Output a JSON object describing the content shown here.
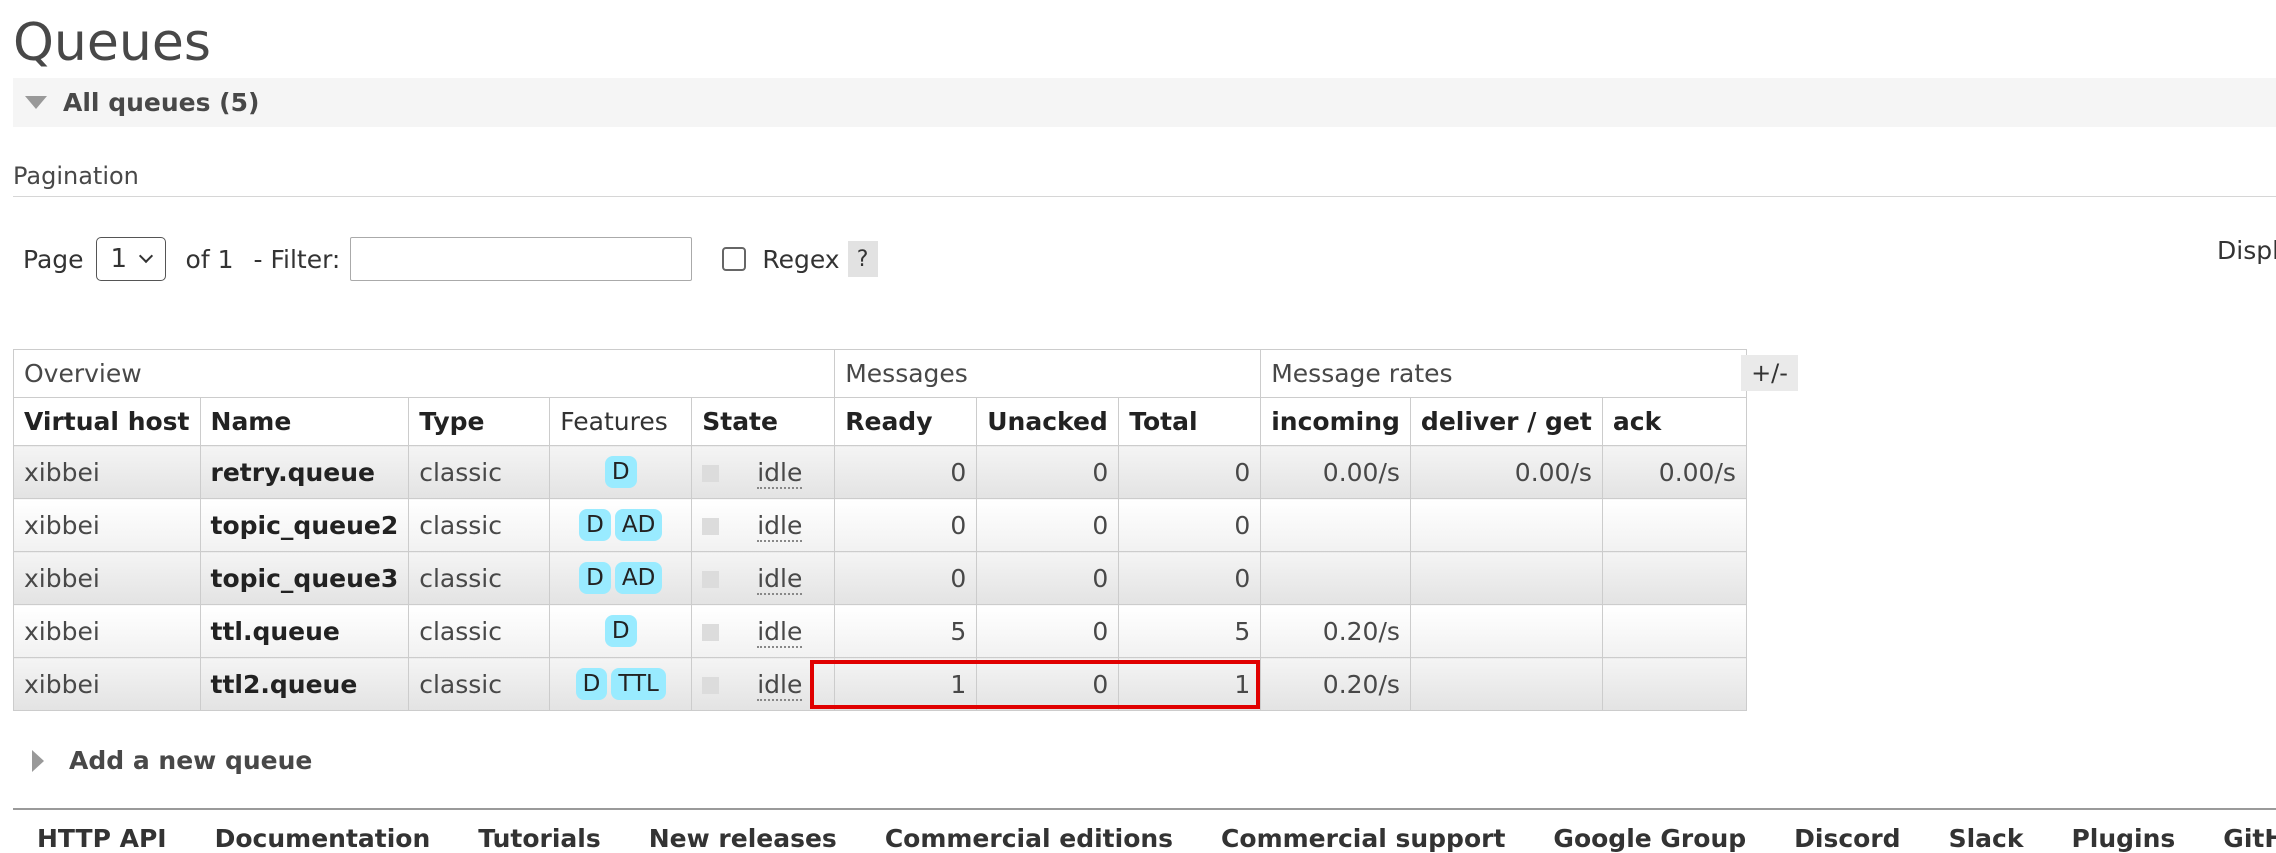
{
  "page_title": "Queues",
  "section": {
    "label": "All queues (5)"
  },
  "pagination": {
    "label": "Pagination",
    "page_label": "Page",
    "page_value": "1",
    "of_label": "of 1",
    "filter_label": "- Filter:",
    "filter_value": "",
    "regex_label": "Regex",
    "help_label": "?",
    "displaying_label": "Displ"
  },
  "table": {
    "groups": [
      "Overview",
      "Messages",
      "Message rates"
    ],
    "columns": [
      "Virtual host",
      "Name",
      "Type",
      "Features",
      "State",
      "Ready",
      "Unacked",
      "Total",
      "incoming",
      "deliver / get",
      "ack"
    ],
    "toggle_label": "+/-",
    "rows": [
      {
        "vhost": "xibbei",
        "name": "retry.queue",
        "type": "classic",
        "features": [
          "D"
        ],
        "state": "idle",
        "ready": "0",
        "unacked": "0",
        "total": "0",
        "incoming": "0.00/s",
        "deliver_get": "0.00/s",
        "ack": "0.00/s"
      },
      {
        "vhost": "xibbei",
        "name": "topic_queue2",
        "type": "classic",
        "features": [
          "D",
          "AD"
        ],
        "state": "idle",
        "ready": "0",
        "unacked": "0",
        "total": "0",
        "incoming": "",
        "deliver_get": "",
        "ack": ""
      },
      {
        "vhost": "xibbei",
        "name": "topic_queue3",
        "type": "classic",
        "features": [
          "D",
          "AD"
        ],
        "state": "idle",
        "ready": "0",
        "unacked": "0",
        "total": "0",
        "incoming": "",
        "deliver_get": "",
        "ack": ""
      },
      {
        "vhost": "xibbei",
        "name": "ttl.queue",
        "type": "classic",
        "features": [
          "D"
        ],
        "state": "idle",
        "ready": "5",
        "unacked": "0",
        "total": "5",
        "incoming": "0.20/s",
        "deliver_get": "",
        "ack": ""
      },
      {
        "vhost": "xibbei",
        "name": "ttl2.queue",
        "type": "classic",
        "features": [
          "D",
          "TTL"
        ],
        "state": "idle",
        "ready": "1",
        "unacked": "0",
        "total": "1",
        "incoming": "0.20/s",
        "deliver_get": "",
        "ack": ""
      }
    ]
  },
  "add_queue_label": "Add a new queue",
  "footer_links": [
    "HTTP API",
    "Documentation",
    "Tutorials",
    "New releases",
    "Commercial editions",
    "Commercial support",
    "Google Group",
    "Discord",
    "Slack",
    "Plugins",
    "GitHub"
  ],
  "colors": {
    "feature_badge": "#99ebff",
    "highlight_border": "#e00000"
  }
}
